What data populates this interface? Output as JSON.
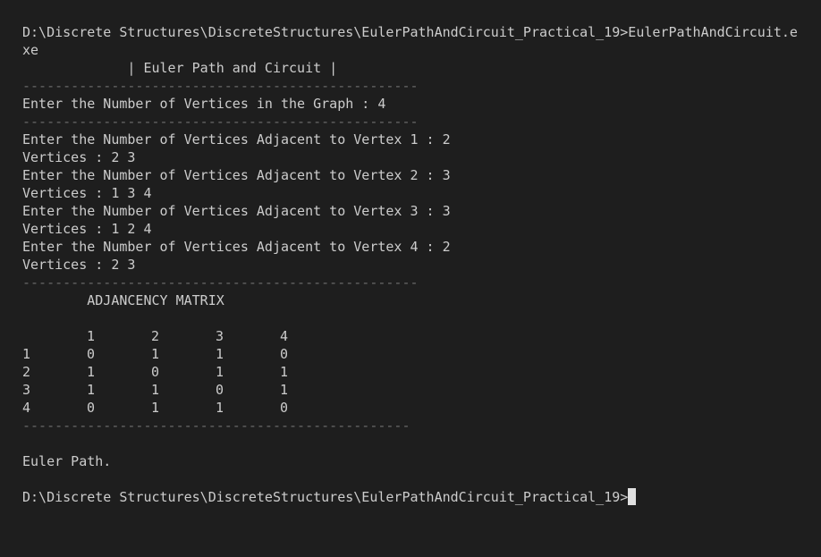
{
  "terminal": {
    "command_line_1": "D:\\Discrete Structures\\DiscreteStructures\\EulerPathAndCircuit_Practical_19>EulerPathAndCircuit.e",
    "command_line_2": "xe",
    "banner": "             | Euler Path and Circuit |",
    "separator_1": "-------------------------------------------------",
    "vertices_prompt": "Enter the Number of Vertices in the Graph : 4",
    "separator_2": "-------------------------------------------------",
    "adjacency_inputs": [
      {
        "prompt": "Enter the Number of Vertices Adjacent to Vertex 1 : 2",
        "vertices": "Vertices : 2 3"
      },
      {
        "prompt": "Enter the Number of Vertices Adjacent to Vertex 2 : 3",
        "vertices": "Vertices : 1 3 4"
      },
      {
        "prompt": "Enter the Number of Vertices Adjacent to Vertex 3 : 3",
        "vertices": "Vertices : 1 2 4"
      },
      {
        "prompt": "Enter the Number of Vertices Adjacent to Vertex 4 : 2",
        "vertices": "Vertices : 2 3"
      }
    ],
    "separator_3": "-------------------------------------------------",
    "matrix_title": "        ADJANCENCY MATRIX",
    "matrix_header": [
      "",
      "1",
      "2",
      "3",
      "4"
    ],
    "matrix_rows": [
      [
        "1",
        "0",
        "1",
        "1",
        "0"
      ],
      [
        "2",
        "1",
        "0",
        "1",
        "1"
      ],
      [
        "3",
        "1",
        "1",
        "0",
        "1"
      ],
      [
        "4",
        "0",
        "1",
        "1",
        "0"
      ]
    ],
    "separator_4": "------------------------------------------------",
    "result": "Euler Path.",
    "prompt_line": "D:\\Discrete Structures\\DiscreteStructures\\EulerPathAndCircuit_Practical_19>"
  }
}
